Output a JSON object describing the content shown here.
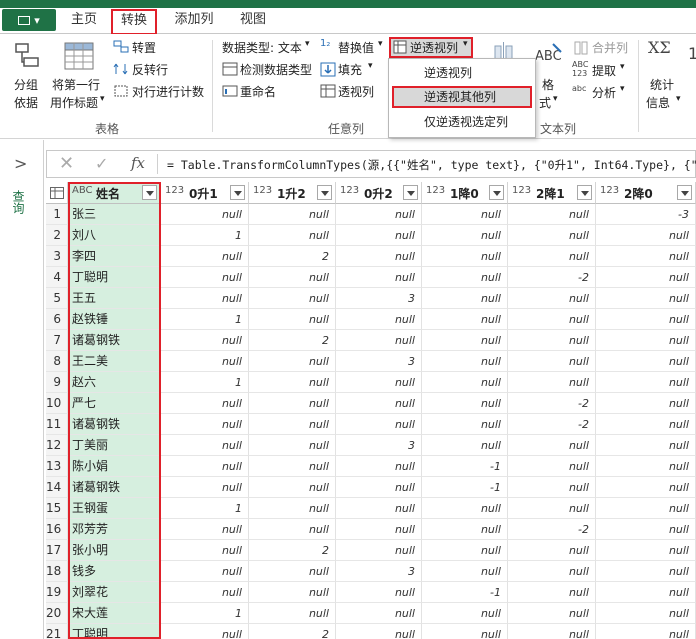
{
  "tabs": {
    "file_label": "",
    "home": "主页",
    "transform": "转换",
    "add_column": "添加列",
    "view": "视图"
  },
  "ribbon": {
    "group_by": [
      "分组",
      "依据"
    ],
    "use_first_row": [
      "将第一行",
      "用作标题"
    ],
    "transpose": "转置",
    "reverse_rows": "反转行",
    "count_rows": "对行进行计数",
    "table_group": "表格",
    "data_type": "数据类型: 文本",
    "detect_type": "检测数据类型",
    "rename": "重命名",
    "replace_values": "替换值",
    "fill": "填充",
    "pivot": "透视列",
    "unpivot": "逆透视列",
    "any_column_group": "任意列",
    "merge_columns": "合并列",
    "extract": "提取",
    "parse": "分析",
    "format": [
      "格",
      "式"
    ],
    "text_column_group": "文本列",
    "statistics": [
      "统计",
      "信息"
    ]
  },
  "dropdown": [
    "逆透视列",
    "逆透视其他列",
    "仅逆透视选定列"
  ],
  "left_pane": {
    "label": "查询"
  },
  "formula": "= Table.TransformColumnTypes(源,{{\"姓名\", type text}, {\"0升1\", Int64.Type}, {\"1升",
  "columns": [
    {
      "type": "ABC",
      "name": "姓名"
    },
    {
      "type": "123",
      "name": "0升1"
    },
    {
      "type": "123",
      "name": "1升2"
    },
    {
      "type": "123",
      "name": "0升2"
    },
    {
      "type": "123",
      "name": "1降0"
    },
    {
      "type": "123",
      "name": "2降1"
    },
    {
      "type": "123",
      "name": "2降0"
    }
  ],
  "rows": [
    [
      "1",
      "张三",
      "null",
      "null",
      "null",
      "null",
      "null",
      "-3"
    ],
    [
      "2",
      "刘八",
      "1",
      "null",
      "null",
      "null",
      "null",
      "null"
    ],
    [
      "3",
      "李四",
      "null",
      "2",
      "null",
      "null",
      "null",
      "null"
    ],
    [
      "4",
      "丁聪明",
      "null",
      "null",
      "null",
      "null",
      "-2",
      "null"
    ],
    [
      "5",
      "王五",
      "null",
      "null",
      "3",
      "null",
      "null",
      "null"
    ],
    [
      "6",
      "赵铁锤",
      "1",
      "null",
      "null",
      "null",
      "null",
      "null"
    ],
    [
      "7",
      "诸葛钢铁",
      "null",
      "2",
      "null",
      "null",
      "null",
      "null"
    ],
    [
      "8",
      "王二美",
      "null",
      "null",
      "3",
      "null",
      "null",
      "null"
    ],
    [
      "9",
      "赵六",
      "1",
      "null",
      "null",
      "null",
      "null",
      "null"
    ],
    [
      "10",
      "严七",
      "null",
      "null",
      "null",
      "null",
      "-2",
      "null"
    ],
    [
      "11",
      "诸葛钢铁",
      "null",
      "null",
      "null",
      "null",
      "-2",
      "null"
    ],
    [
      "12",
      "丁美丽",
      "null",
      "null",
      "3",
      "null",
      "null",
      "null"
    ],
    [
      "13",
      "陈小娟",
      "null",
      "null",
      "null",
      "-1",
      "null",
      "null"
    ],
    [
      "14",
      "诸葛钢铁",
      "null",
      "null",
      "null",
      "-1",
      "null",
      "null"
    ],
    [
      "15",
      "王钢蛋",
      "1",
      "null",
      "null",
      "null",
      "null",
      "null"
    ],
    [
      "16",
      "邓芳芳",
      "null",
      "null",
      "null",
      "null",
      "-2",
      "null"
    ],
    [
      "17",
      "张小明",
      "null",
      "2",
      "null",
      "null",
      "null",
      "null"
    ],
    [
      "18",
      "钱多",
      "null",
      "null",
      "3",
      "null",
      "null",
      "null"
    ],
    [
      "19",
      "刘翠花",
      "null",
      "null",
      "null",
      "-1",
      "null",
      "null"
    ],
    [
      "20",
      "宋大莲",
      "1",
      "null",
      "null",
      "null",
      "null",
      "null"
    ],
    [
      "21",
      "丁聪明",
      "null",
      "2",
      "null",
      "null",
      "null",
      "null"
    ]
  ]
}
